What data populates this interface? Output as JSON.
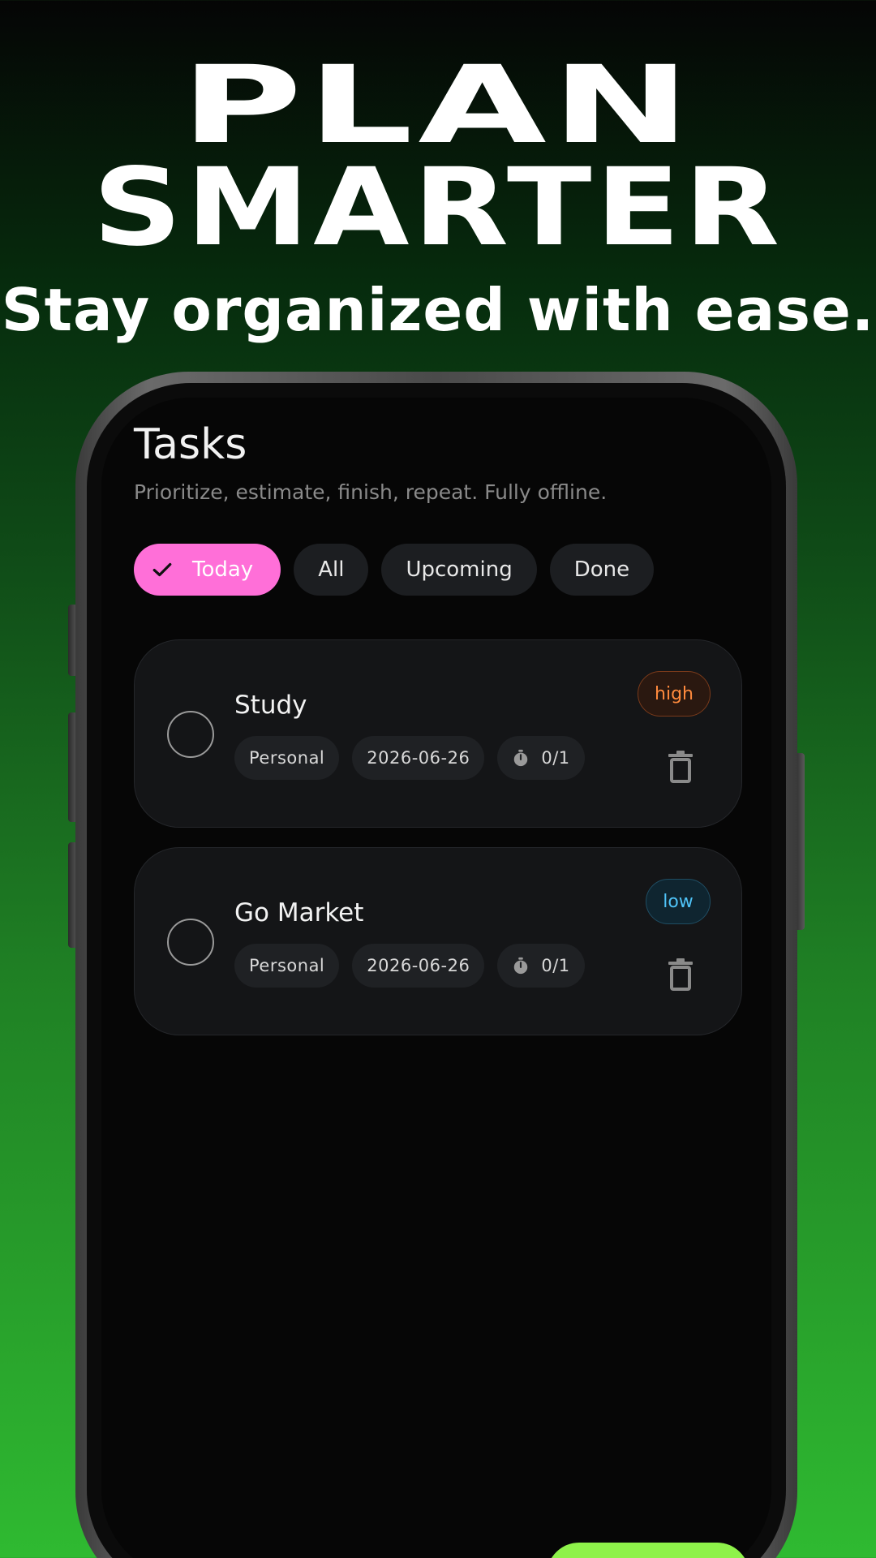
{
  "hero": {
    "line1": "PLAN",
    "line2": "SMARTER",
    "subtitle": "Stay organized with ease."
  },
  "screen": {
    "title": "Tasks",
    "subtitle": "Prioritize, estimate, finish, repeat. Fully offline."
  },
  "filters": [
    {
      "label": "Today",
      "active": true,
      "icon": "check-icon"
    },
    {
      "label": "All",
      "active": false
    },
    {
      "label": "Upcoming",
      "active": false
    },
    {
      "label": "Done",
      "active": false
    }
  ],
  "tasks": [
    {
      "title": "Study",
      "category": "Personal",
      "date": "2026-06-26",
      "pomodoro": "0/1",
      "priority": "high",
      "completed": false
    },
    {
      "title": "Go Market",
      "category": "Personal",
      "date": "2026-06-26",
      "pomodoro": "0/1",
      "priority": "low",
      "completed": false
    }
  ],
  "icons": {
    "check": "check-icon",
    "timer": "timer-icon",
    "delete": "trash-icon"
  },
  "colors": {
    "active_filter": "#ff6fd8",
    "priority_high": "#ff8a3d",
    "priority_low": "#4fc3f7",
    "fab": "#8ef24a",
    "background_top": "#050505",
    "background_bottom": "#2fba31"
  }
}
